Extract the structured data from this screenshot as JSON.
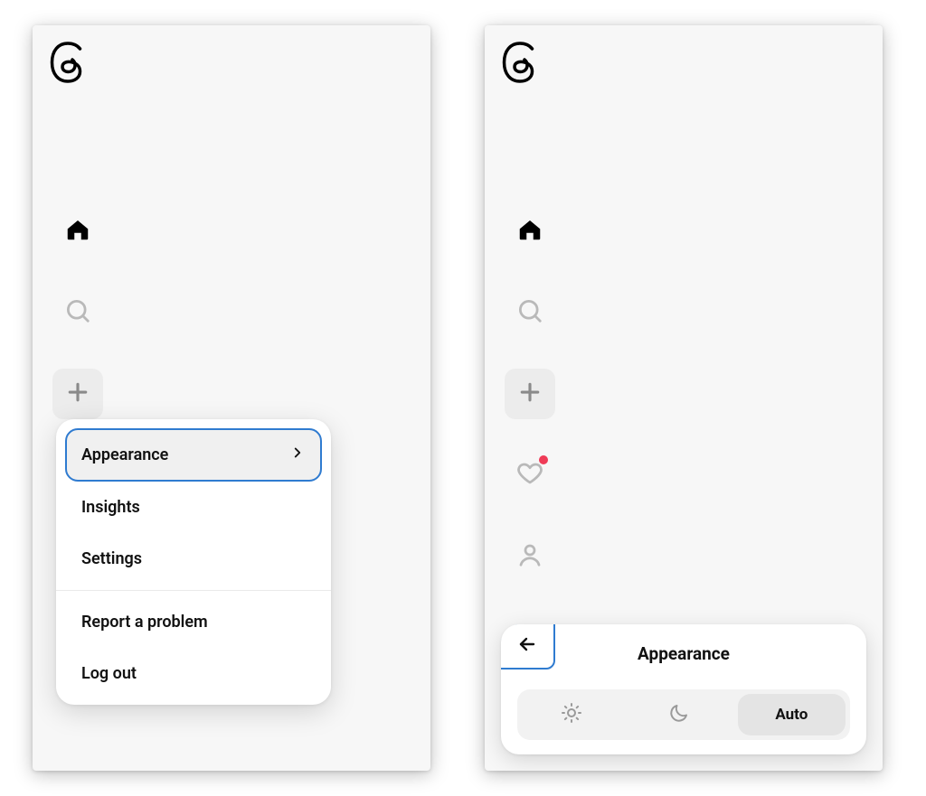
{
  "colors": {
    "accent": "#2f7bd0",
    "notification_dot": "#ef3b57",
    "icon_inactive": "#b9b9b9",
    "icon_active": "#000000"
  },
  "left": {
    "menu": {
      "appearance": "Appearance",
      "insights": "Insights",
      "settings": "Settings",
      "report": "Report a problem",
      "logout": "Log out"
    }
  },
  "right": {
    "panel": {
      "title": "Appearance",
      "auto": "Auto"
    }
  }
}
